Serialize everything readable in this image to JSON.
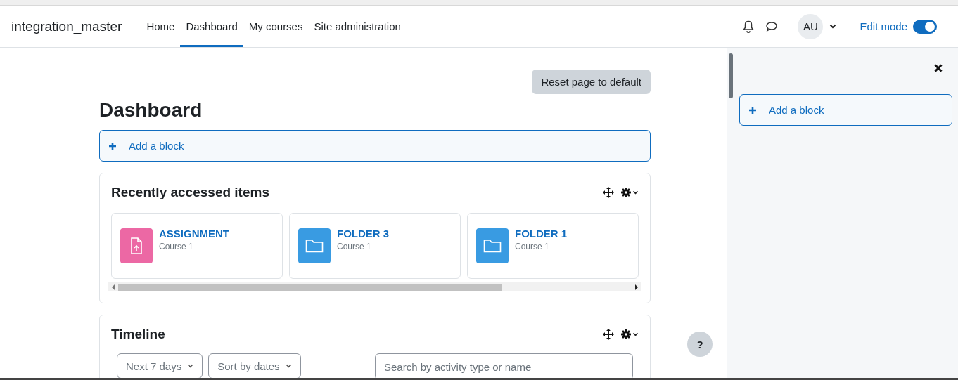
{
  "site_name": "integration_master",
  "nav": [
    {
      "label": "Home",
      "selected": false
    },
    {
      "label": "Dashboard",
      "selected": true
    },
    {
      "label": "My courses",
      "selected": false
    },
    {
      "label": "Site administration",
      "selected": false
    }
  ],
  "user": {
    "initials": "AU"
  },
  "edit_mode": {
    "label": "Edit mode",
    "on": true
  },
  "reset_button": "Reset page to default",
  "page_title": "Dashboard",
  "add_block": "Add a block",
  "recent": {
    "title": "Recently accessed items",
    "items": [
      {
        "name": "ASSIGNMENT",
        "course": "Course 1",
        "kind": "assignment",
        "color": "#ec68a4"
      },
      {
        "name": "FOLDER 3",
        "course": "Course 1",
        "kind": "folder",
        "color": "#399be2"
      },
      {
        "name": "FOLDER 1",
        "course": "Course 1",
        "kind": "folder",
        "color": "#399be2"
      }
    ]
  },
  "timeline": {
    "title": "Timeline",
    "filters": [
      "Next 7 days",
      "Sort by dates"
    ],
    "search": {
      "placeholder": "Search by activity type or name"
    }
  },
  "help": "?",
  "drawer": {
    "add_block": "Add a block"
  }
}
